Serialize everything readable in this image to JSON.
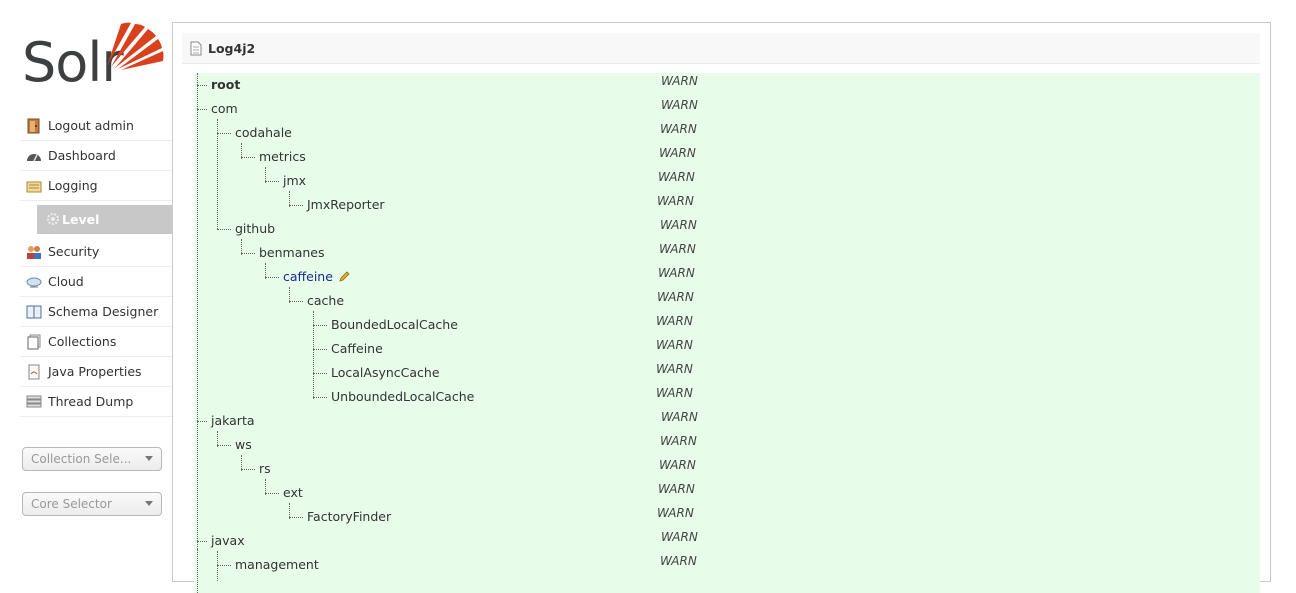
{
  "brand": {
    "logo_text": "Solr",
    "accent": "#d9411e"
  },
  "sidebar": {
    "items": [
      {
        "label": "Logout admin",
        "icon": "door-icon"
      },
      {
        "label": "Dashboard",
        "icon": "dashboard-icon"
      },
      {
        "label": "Logging",
        "icon": "logging-icon"
      },
      {
        "label": "Security",
        "icon": "users-icon"
      },
      {
        "label": "Cloud",
        "icon": "cloud-icon"
      },
      {
        "label": "Schema Designer",
        "icon": "book-icon"
      },
      {
        "label": "Collections",
        "icon": "collections-icon"
      },
      {
        "label": "Java Properties",
        "icon": "java-icon"
      },
      {
        "label": "Thread Dump",
        "icon": "stack-icon"
      }
    ],
    "logging_sub": {
      "label": "Level",
      "icon": "gear-icon"
    },
    "collection_selector": "Collection Sele...",
    "core_selector": "Core Selector"
  },
  "panel": {
    "title": "Log4j2",
    "icon": "document-icon"
  },
  "tree": [
    {
      "name": "root",
      "level": "WARN"
    },
    {
      "name": "com",
      "level": "WARN"
    },
    {
      "name": "codahale",
      "level": "WARN"
    },
    {
      "name": "metrics",
      "level": "WARN"
    },
    {
      "name": "jmx",
      "level": "WARN"
    },
    {
      "name": "JmxReporter",
      "level": "WARN"
    },
    {
      "name": "github",
      "level": "WARN"
    },
    {
      "name": "benmanes",
      "level": "WARN"
    },
    {
      "name": "caffeine",
      "level": "WARN"
    },
    {
      "name": "cache",
      "level": "WARN"
    },
    {
      "name": "BoundedLocalCache",
      "level": "WARN"
    },
    {
      "name": "Caffeine",
      "level": "WARN"
    },
    {
      "name": "LocalAsyncCache",
      "level": "WARN"
    },
    {
      "name": "UnboundedLocalCache",
      "level": "WARN"
    },
    {
      "name": "jakarta",
      "level": "WARN"
    },
    {
      "name": "ws",
      "level": "WARN"
    },
    {
      "name": "rs",
      "level": "WARN"
    },
    {
      "name": "ext",
      "level": "WARN"
    },
    {
      "name": "FactoryFinder",
      "level": "WARN"
    },
    {
      "name": "javax",
      "level": "WARN"
    },
    {
      "name": "management",
      "level": "WARN"
    }
  ]
}
